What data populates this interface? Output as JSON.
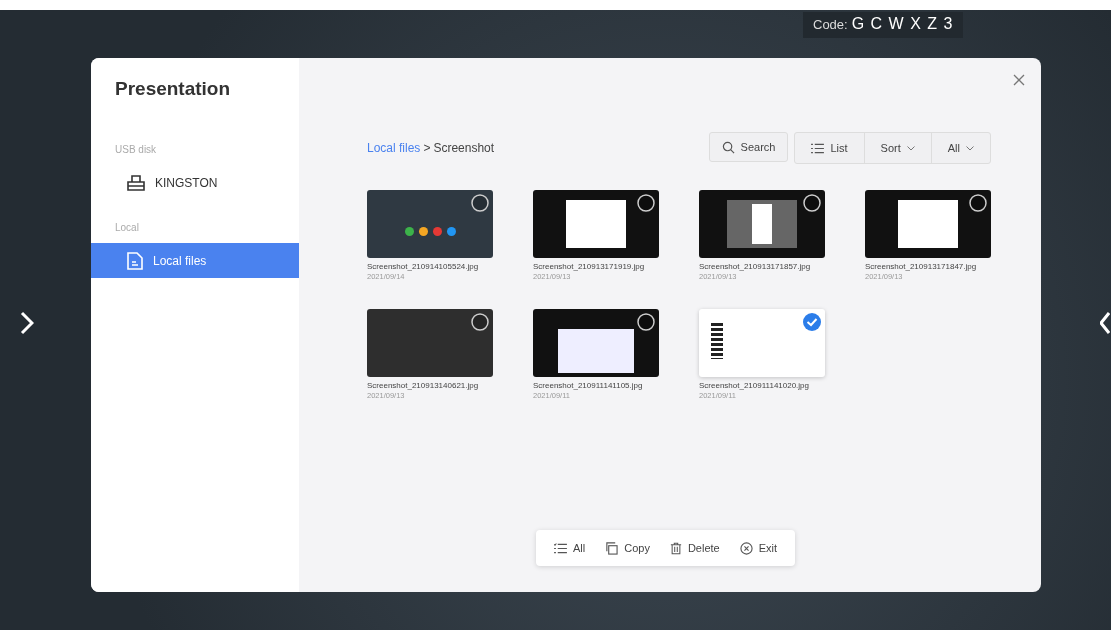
{
  "code_badge": {
    "label": "Code:",
    "value": "G C W X Z 3"
  },
  "sidebar": {
    "title": "Presentation",
    "sections": [
      {
        "heading": "USB disk",
        "items": [
          {
            "label": "KINGSTON",
            "kind": "usb",
            "selected": false
          }
        ]
      },
      {
        "heading": "Local",
        "items": [
          {
            "label": "Local files",
            "kind": "folder",
            "selected": true
          }
        ]
      }
    ]
  },
  "breadcrumb": {
    "link": "Local files",
    "separator": ">",
    "current": "Screenshot"
  },
  "toolbar": {
    "search": "Search",
    "view": "List",
    "sort": "Sort",
    "filter": "All"
  },
  "files": [
    {
      "name": "Screenshot_210914105524.jpg",
      "date": "2021/09/14",
      "kind": "home",
      "selected": false
    },
    {
      "name": "Screenshot_210913171919.jpg",
      "date": "2021/09/13",
      "kind": "dialog",
      "selected": false
    },
    {
      "name": "Screenshot_210913171857.jpg",
      "date": "2021/09/13",
      "kind": "dim",
      "selected": false
    },
    {
      "name": "Screenshot_210913171847.jpg",
      "date": "2021/09/13",
      "kind": "dialog",
      "selected": false
    },
    {
      "name": "Screenshot_210913140621.jpg",
      "date": "2021/09/13",
      "kind": "blank",
      "selected": false
    },
    {
      "name": "Screenshot_210911141105.jpg",
      "date": "2021/09/11",
      "kind": "calendar",
      "selected": false
    },
    {
      "name": "Screenshot_210911141020.jpg",
      "date": "2021/09/11",
      "kind": "light",
      "selected": true
    }
  ],
  "actions": [
    {
      "label": "All",
      "kind": "all"
    },
    {
      "label": "Copy",
      "kind": "copy"
    },
    {
      "label": "Delete",
      "kind": "delete"
    },
    {
      "label": "Exit",
      "kind": "exit"
    }
  ]
}
